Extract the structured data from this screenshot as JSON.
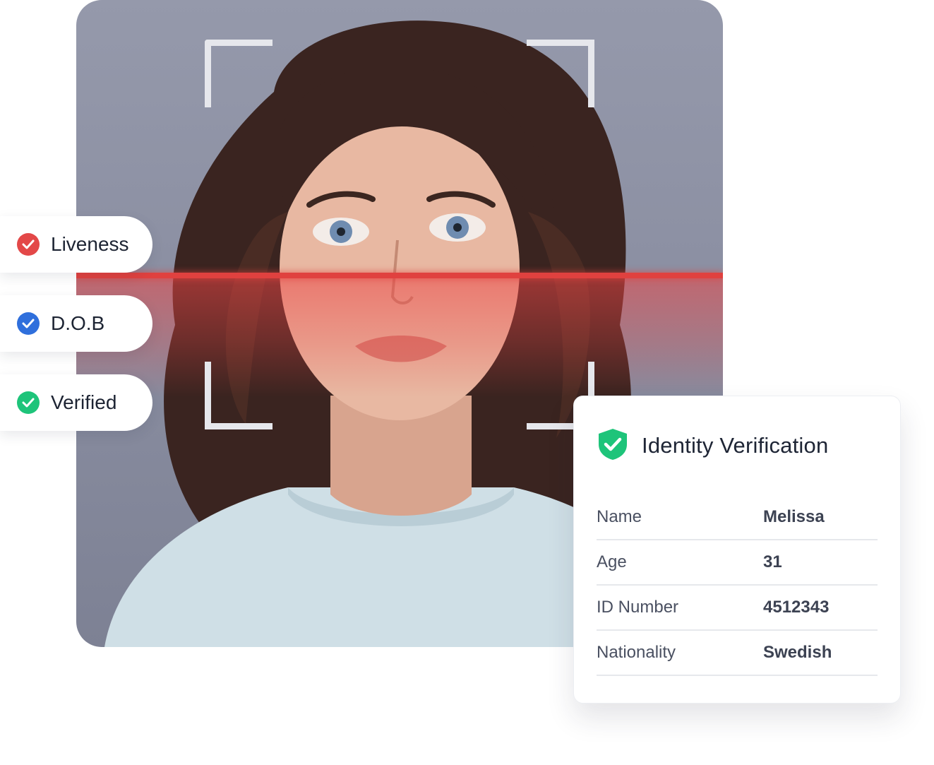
{
  "statuses": [
    {
      "label": "Liveness",
      "color": "#e34848",
      "icon": "check-icon"
    },
    {
      "label": "D.O.B",
      "color": "#2f6fdc",
      "icon": "check-icon"
    },
    {
      "label": "Verified",
      "color": "#1ec47a",
      "icon": "check-icon"
    }
  ],
  "card": {
    "title": "Identity Verification",
    "shield_color": "#1ec47a",
    "rows": [
      {
        "key": "Name",
        "value": "Melissa"
      },
      {
        "key": "Age",
        "value": "31"
      },
      {
        "key": "ID Number",
        "value": "4512343"
      },
      {
        "key": "Nationality",
        "value": "Swedish"
      }
    ]
  },
  "colors": {
    "scan_line": "#e0413f",
    "background": "#9599ab"
  }
}
